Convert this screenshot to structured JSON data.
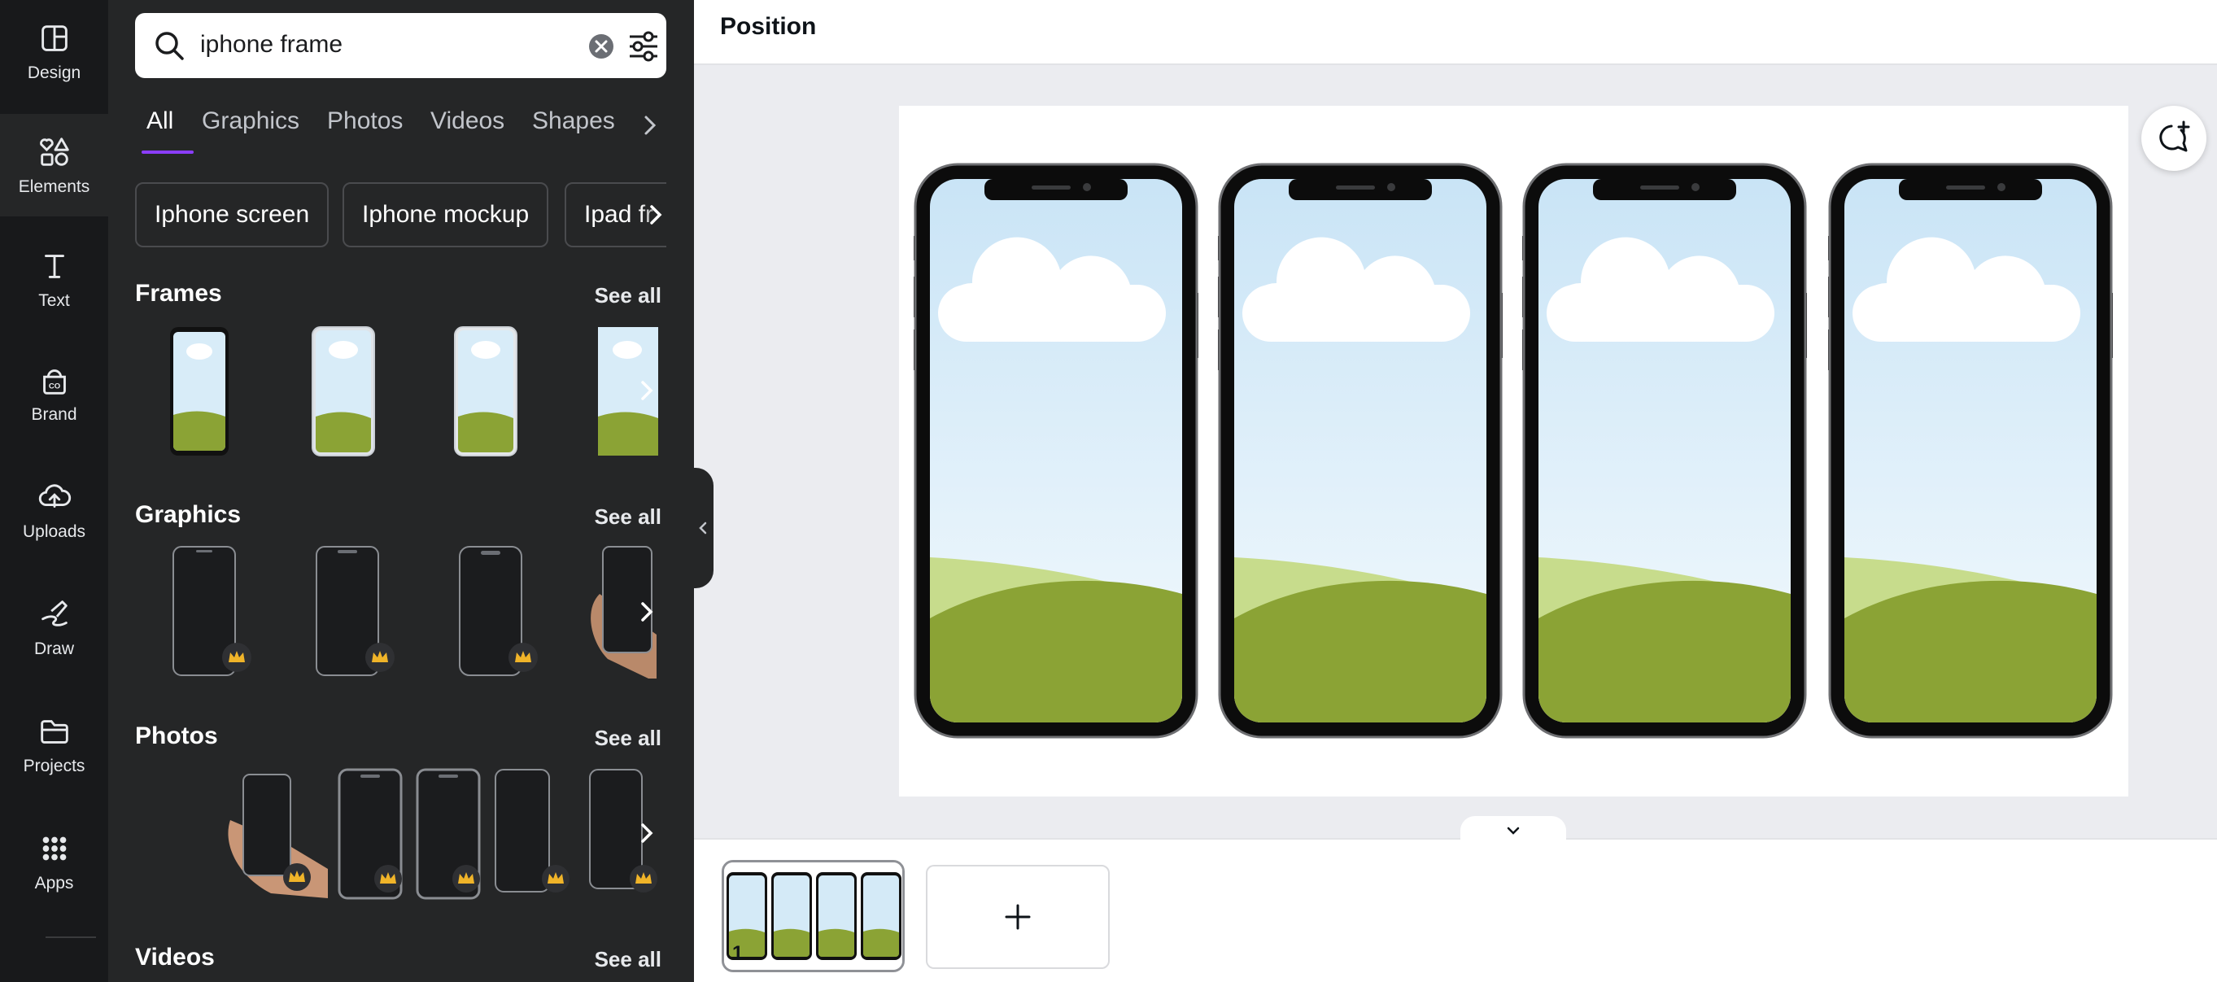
{
  "rail": {
    "items": [
      {
        "label": "Design",
        "icon": "design-icon"
      },
      {
        "label": "Elements",
        "icon": "elements-icon"
      },
      {
        "label": "Text",
        "icon": "text-icon"
      },
      {
        "label": "Brand",
        "icon": "brand-icon"
      },
      {
        "label": "Uploads",
        "icon": "uploads-icon"
      },
      {
        "label": "Draw",
        "icon": "draw-icon"
      },
      {
        "label": "Projects",
        "icon": "projects-icon"
      },
      {
        "label": "Apps",
        "icon": "apps-icon"
      }
    ],
    "active": "Elements"
  },
  "search": {
    "value": "iphone frame"
  },
  "tabs": [
    "All",
    "Graphics",
    "Photos",
    "Videos",
    "Shapes"
  ],
  "active_tab": "All",
  "chips": [
    "Iphone screen",
    "Iphone mockup",
    "Ipad fr"
  ],
  "sections": {
    "frames": {
      "title": "Frames",
      "see_all": "See all"
    },
    "graphics": {
      "title": "Graphics",
      "see_all": "See all"
    },
    "photos": {
      "title": "Photos",
      "see_all": "See all"
    },
    "videos": {
      "title": "Videos",
      "see_all": "See all"
    }
  },
  "topbar": {
    "title": "Position"
  },
  "pages": {
    "current": "1"
  },
  "colors": {
    "accent": "#8b3dff",
    "panel": "#252627",
    "rail": "#18191b",
    "grass": "#8ba335",
    "sky": "#cfe6f5"
  }
}
